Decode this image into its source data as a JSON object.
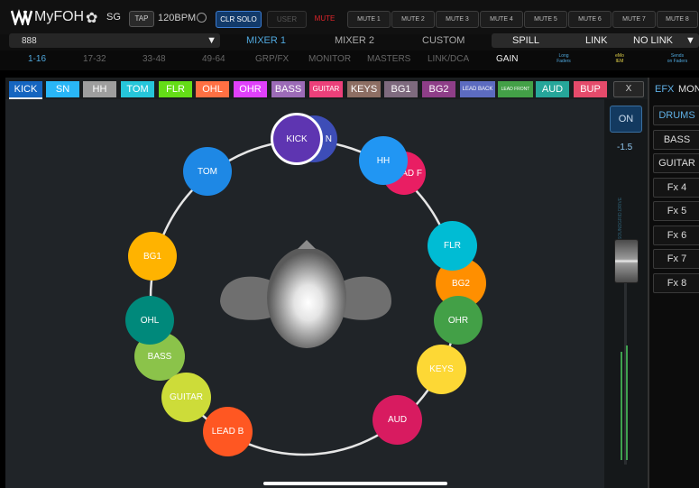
{
  "header": {
    "app_name": "MyFOH",
    "sg": "SG",
    "tap": "TAP",
    "bpm": "120BPM",
    "clr_solo": "CLR SOLO",
    "user": "USER",
    "mute": "MUTE",
    "mute_buttons": [
      "MUTE 1",
      "MUTE 2",
      "MUTE 3",
      "MUTE 4",
      "MUTE 5",
      "MUTE 6",
      "MUTE 7",
      "MUTE 8"
    ]
  },
  "row2": {
    "session": "888",
    "mixer1": "MIXER 1",
    "mixer2": "MIXER 2",
    "custom": "CUSTOM",
    "spill": "SPILL",
    "link": "LINK",
    "no_link": "NO LINK"
  },
  "row3": {
    "items": [
      "1-16",
      "17-32",
      "33-48",
      "49-64",
      "GRP/FX",
      "MONITOR",
      "MASTERS",
      "LINK/DCA",
      "GAIN"
    ],
    "long_faders": [
      "Long",
      "Faders"
    ],
    "emo_iem": [
      "eMo",
      "IEM"
    ],
    "sends_on_faders": [
      "Sends",
      "on Faders"
    ]
  },
  "channels": [
    "KICK",
    "SN",
    "HH",
    "TOM",
    "FLR",
    "OHL",
    "OHR",
    "BASS",
    "GUITAR",
    "KEYS",
    "BG1",
    "BG2",
    "LEAD BACK",
    "LEAD FRONT",
    "AUD",
    "BUP"
  ],
  "close_label": "X",
  "fader": {
    "on": "ON",
    "value": "-1.5",
    "label": "SOUNDGRID.DRIVE"
  },
  "efx": {
    "tabs": [
      "EFX",
      "MON"
    ],
    "items": [
      "DRUMS",
      "BASS",
      "GUITAR",
      "Fx 4",
      "Fx 5",
      "Fx 6",
      "Fx 7",
      "Fx 8"
    ]
  },
  "ring": {
    "kick": "KICK",
    "sn": "N",
    "hh": "HH",
    "lead_f": "AD F",
    "tom": "TOM",
    "bg1": "BG1",
    "ohl": "OHL",
    "bass": "BASS",
    "guitar": "GUITAR",
    "lead_b": "LEAD B",
    "aud": "AUD",
    "keys": "KEYS",
    "ohr": "OHR",
    "bg2": "BG2",
    "flr": "FLR"
  },
  "colors": {
    "kick": "#5e35b1",
    "sn": "#3d4db7",
    "hh": "#2196f3",
    "lead_f": "#e91e63",
    "tom": "#1e88e5",
    "bg1": "#ffb300",
    "ohl": "#00897b",
    "bass": "#8bc34a",
    "guitar": "#cddc39",
    "lead_b": "#ff5722",
    "aud": "#d81b60",
    "keys": "#fdd835",
    "ohr": "#43a047",
    "bg2": "#ff8f00",
    "flr": "#00bcd4"
  }
}
